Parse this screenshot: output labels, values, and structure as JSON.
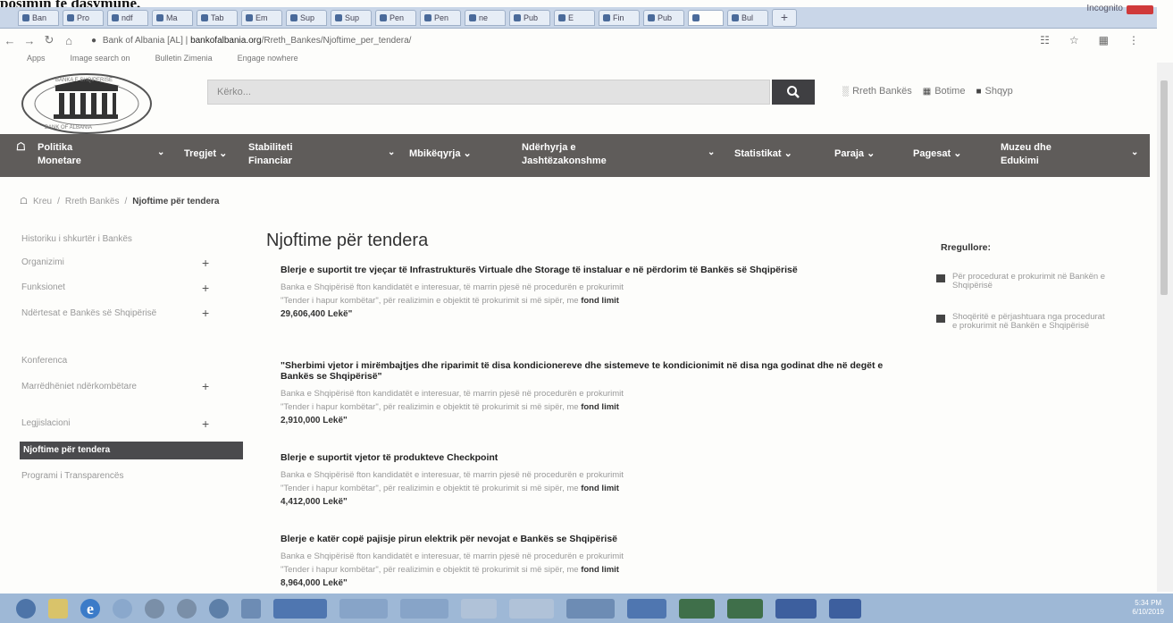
{
  "caption": "posimin té dasymune,",
  "browser": {
    "tabs": [
      "Ban",
      "Pro",
      "ndf",
      "Ma",
      "Tab",
      "Em",
      "Sup",
      "Sup",
      "Pen",
      "Pen",
      "ne",
      "Pub",
      "E",
      "Fin",
      "Pub",
      "",
      "Bul"
    ],
    "window_title": "Incognito",
    "address": {
      "title": "Bank of Albania [AL]",
      "domain": "bankofalbania.org",
      "path": "/Rreth_Bankes/Njoftime_per_tendera/"
    },
    "bookmarks": [
      "Apps",
      "Image search on",
      "Bulletin Zimenia",
      "Engage nowhere"
    ]
  },
  "site": {
    "search_placeholder": "Kërko...",
    "header_links": [
      "Rreth Bankës",
      "Botime",
      "Shqyp"
    ],
    "nav": [
      {
        "line1": "Politika",
        "line2": "Monetare"
      },
      {
        "line1": "Tregjet",
        "line2": ""
      },
      {
        "line1": "Stabiliteti",
        "line2": "Financiar"
      },
      {
        "line1": "Mbikëqyrja",
        "line2": ""
      },
      {
        "line1": "Ndërhyrja e",
        "line2": "Jashtëzakonshme"
      },
      {
        "line1": "Statistikat",
        "line2": ""
      },
      {
        "line1": "Paraja",
        "line2": ""
      },
      {
        "line1": "Pagesat",
        "line2": ""
      },
      {
        "line1": "Muzeu dhe",
        "line2": "Edukimi"
      }
    ],
    "breadcrumb": {
      "home": "Kreu",
      "parent": "Rreth Bankës",
      "current": "Njoftime për tendera"
    },
    "sidebar": [
      {
        "label": "Historiku i shkurtër i Bankës",
        "plus": false
      },
      {
        "label": "Organizimi",
        "plus": true
      },
      {
        "label": "Funksionet",
        "plus": true
      },
      {
        "label": "Ndërtesat e Bankës së Shqipërisë",
        "plus": true
      },
      {
        "label": "Konferenca",
        "plus": false
      },
      {
        "label": "Marrëdhëniet ndërkombëtare",
        "plus": true
      },
      {
        "label": "Legjislacioni",
        "plus": true
      },
      {
        "label": "Njoftime për tendera",
        "plus": false,
        "active": true
      },
      {
        "label": "Programi i Transparencës",
        "plus": false
      }
    ],
    "page_title": "Njoftime për tendera",
    "entries": [
      {
        "title": "Blerje e suportit tre vjeçar të Infrastrukturës Virtuale dhe Storage të instaluar e në përdorim të Bankës së Shqipërisë",
        "line1": "Banka e Shqipërisë fton kandidatët e interesuar, të marrin pjesë në procedurën e prokurimit",
        "line2": "\"Tender i hapur kombëtar\", për realizimin e objektit të prokurimit si më sipër, me",
        "fond_label": "fond limit",
        "amount": "29,606,400 Lekë\""
      },
      {
        "title": "\"Sherbimi vjetor i mirëmbajtjes dhe riparimit të disa kondicionereve dhe sistemeve te kondicionimit në disa nga godinat dhe në degët e Bankës se Shqipërisë\"",
        "line1": "Banka e Shqipërisë fton kandidatët e interesuar, të marrin pjesë në procedurën e prokurimit",
        "line2": "\"Tender i hapur kombëtar\", për realizimin e objektit të prokurimit si më sipër, me",
        "fond_label": "fond limit",
        "amount": "2,910,000 Lekë\""
      },
      {
        "title": "Blerje e suportit vjetor të produkteve Checkpoint",
        "line1": "Banka e Shqipërisë fton kandidatët e interesuar, të marrin pjesë në procedurën e prokurimit",
        "line2": "\"Tender i hapur kombëtar\", për realizimin e objektit të prokurimit si më sipër, me",
        "fond_label": "fond limit",
        "amount": "4,412,000 Lekë\""
      },
      {
        "title": "Blerje e katër copë pajisje pirun elektrik për nevojat e Bankës se Shqipërisë",
        "line1": "Banka e Shqipërisë fton kandidatët e interesuar, të marrin pjesë në procedurën e prokurimit",
        "line2": "\"Tender i hapur kombëtar\", për realizimin e objektit të prokurimit si më sipër, me",
        "fond_label": "fond limit",
        "amount": "8,964,000 Lekë\""
      }
    ],
    "rules": {
      "title": "Rregullore:",
      "items": [
        "Për procedurat e prokurimit në Bankën e Shqipërisë",
        "Shoqëritë e përjashtuara nga procedurat e prokurimit në Bankën e Shqipërisë"
      ]
    }
  },
  "taskbar": {
    "time": "5:34 PM",
    "date": "6/10/2019"
  }
}
